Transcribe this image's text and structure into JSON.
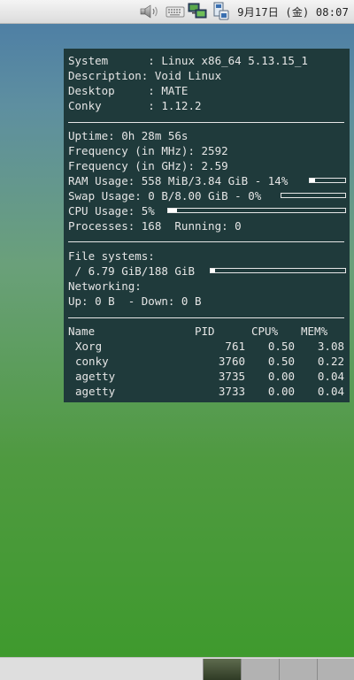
{
  "top_panel": {
    "clock": "9月17日 (金) 08:07",
    "tray_icons": [
      "volume-icon",
      "keyboard-icon",
      "network-icon",
      "battery-icon"
    ]
  },
  "conky": {
    "system_lines": [
      "System      : Linux x86_64 5.13.15_1",
      "Description: Void Linux",
      "Desktop     : MATE",
      "Conky       : 1.12.2"
    ],
    "uptime": "Uptime: 0h 28m 56s",
    "freq_mhz": "Frequency (in MHz): 2592",
    "freq_ghz": "Frequency (in GHz): 2.59",
    "ram": {
      "text": "RAM Usage: 558 MiB/3.84 GiB - 14%",
      "percent": 14
    },
    "swap": {
      "text": "Swap Usage: 0 B/8.00 GiB - 0%",
      "percent": 0
    },
    "cpu": {
      "text": "CPU Usage: 5%",
      "percent": 5
    },
    "processes": "Processes: 168  Running: 0",
    "fs_heading": "File systems:",
    "fs_root": {
      "text": " / 6.79 GiB/188 GiB",
      "percent": 3.6
    },
    "net_heading": "Networking:",
    "net_line": "Up: 0 B  - Down: 0 B",
    "proc_header": {
      "name": "Name",
      "pid": "PID",
      "cpu": "CPU%",
      "mem": "MEM%"
    },
    "proc_rows": [
      {
        "name": "Xorg",
        "pid": "761",
        "cpu": "0.50",
        "mem": "3.08"
      },
      {
        "name": "conky",
        "pid": "3760",
        "cpu": "0.50",
        "mem": "0.22"
      },
      {
        "name": "agetty",
        "pid": "3735",
        "cpu": "0.00",
        "mem": "0.04"
      },
      {
        "name": "agetty",
        "pid": "3733",
        "cpu": "0.00",
        "mem": "0.04"
      }
    ]
  },
  "bottom_panel": {
    "workspaces": [
      "workspace-1",
      "workspace-2",
      "workspace-3",
      "workspace-4"
    ],
    "active_workspace": 0
  }
}
